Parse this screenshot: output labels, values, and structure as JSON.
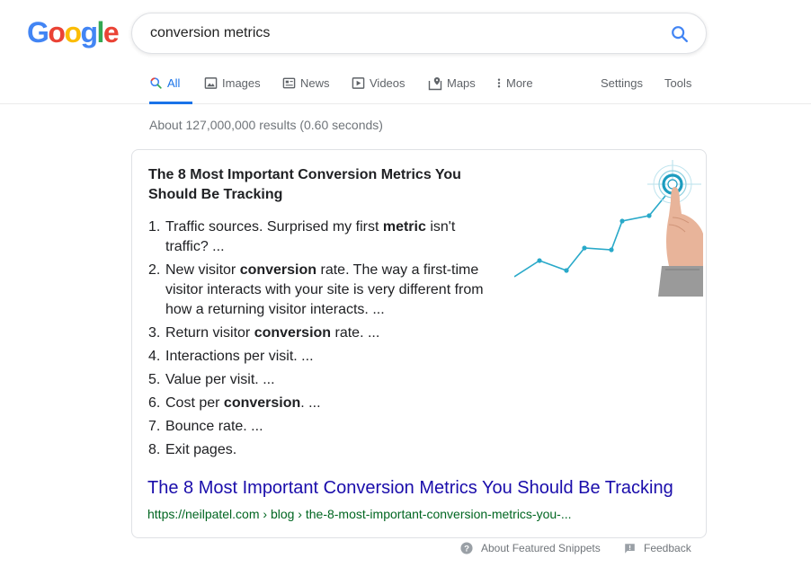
{
  "logo": {
    "letters": [
      "G",
      "o",
      "o",
      "g",
      "l",
      "e"
    ],
    "colors": [
      "#4285F4",
      "#EA4335",
      "#FBBC05",
      "#4285F4",
      "#34A853",
      "#EA4335"
    ]
  },
  "search": {
    "query": "conversion metrics"
  },
  "tabs": [
    {
      "label": "All",
      "icon": "search-icon",
      "active": true
    },
    {
      "label": "Images",
      "icon": "image-icon"
    },
    {
      "label": "News",
      "icon": "news-icon"
    },
    {
      "label": "Videos",
      "icon": "play-icon"
    },
    {
      "label": "Maps",
      "icon": "map-icon"
    },
    {
      "label": "More",
      "icon": "more-vert-icon"
    },
    {
      "label": "Settings"
    },
    {
      "label": "Tools"
    }
  ],
  "result_stats": "About 127,000,000 results (0.60 seconds)",
  "snippet": {
    "title_pre": "The 8 Most Important ",
    "title_bold": "Conversion Metrics",
    "title_post": " You Should Be Tracking",
    "items": [
      {
        "num": "1.",
        "pre": "Traffic sources. Surprised my first ",
        "bold": "metric",
        "post": " isn't traffic? ..."
      },
      {
        "num": "2.",
        "pre": "New visitor ",
        "bold": "conversion",
        "post": " rate. The way a first-time visitor interacts with your site is very different from how a returning visitor interacts. ..."
      },
      {
        "num": "3.",
        "pre": "Return visitor ",
        "bold": "conversion",
        "post": " rate. ..."
      },
      {
        "num": "4.",
        "pre": "Interactions per visit. ...",
        "bold": "",
        "post": ""
      },
      {
        "num": "5.",
        "pre": "Value per visit. ...",
        "bold": "",
        "post": ""
      },
      {
        "num": "6.",
        "pre": "Cost per ",
        "bold": "conversion",
        "post": ". ..."
      },
      {
        "num": "7.",
        "pre": "Bounce rate. ...",
        "bold": "",
        "post": ""
      },
      {
        "num": "8.",
        "pre": "Exit pages.",
        "bold": "",
        "post": ""
      }
    ],
    "link_text": "The 8 Most Important Conversion Metrics You Should Be Tracking",
    "url": "https://neilpatel.com › blog › the-8-most-important-conversion-metrics-you-..."
  },
  "footer": {
    "about": "About Featured Snippets",
    "feedback": "Feedback"
  },
  "colors": {
    "link": "#1a0dab",
    "url": "#006621",
    "accent": "#1a73e8",
    "muted": "#70757a"
  }
}
